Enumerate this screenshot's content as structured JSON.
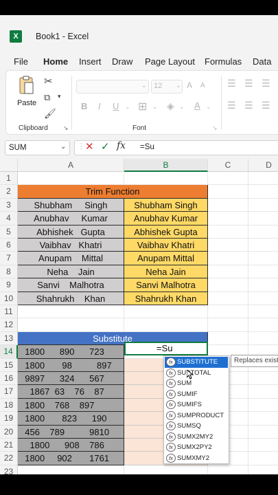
{
  "app": {
    "logo": "X",
    "title": "Book1  -  Excel"
  },
  "tabs": [
    "File",
    "Home",
    "Insert",
    "Draw",
    "Page Layout",
    "Formulas",
    "Data"
  ],
  "ribbon": {
    "paste_label": "Paste",
    "clipboard_label": "Clipboard",
    "font_label": "Font",
    "font_size": "12",
    "bold": "B",
    "italic": "I",
    "underline": "U",
    "font_color": "A"
  },
  "formula_bar": {
    "name_box": "SUM",
    "fx": "fx",
    "formula": "=Su"
  },
  "columns": [
    "A",
    "B",
    "C",
    "D"
  ],
  "rows": [
    "1",
    "2",
    "3",
    "4",
    "5",
    "6",
    "7",
    "8",
    "9",
    "10",
    "11",
    "12",
    "13",
    "14",
    "15",
    "16",
    "17",
    "18",
    "19",
    "20",
    "21",
    "22",
    "23"
  ],
  "trim": {
    "header": "Trim Function",
    "raw": [
      "Shubham     Singh",
      "Anubhav     Kumar",
      "Abhishek   Gupta",
      "Vaibhav   Khatri",
      "Anupam    Mittal",
      "Neha    Jain",
      "Sanvi    Malhotra",
      "Shahrukh    Khan"
    ],
    "clean": [
      "Shubham Singh",
      "Anubhav Kumar",
      "Abhishek Gupta",
      "Vaibhav Khatri",
      "Anupam Mittal",
      "Neha Jain",
      "Sanvi Malhotra",
      "Shahrukh Khan"
    ]
  },
  "substitute": {
    "header": "Substitute",
    "values": [
      "  1800      890      723",
      "  1800       98          897",
      "  9897      324      567",
      "    1867  63    76    87",
      "  1800    768    897",
      "  1800       823      190",
      "  456    789          9810",
      "    1800      908    786",
      "  1800     902       1761"
    ],
    "active_value": "=Su"
  },
  "autocomplete": {
    "items": [
      "SUBSTITUTE",
      "SUBTOTAL",
      "SUM",
      "SUMIF",
      "SUMIFS",
      "SUMPRODUCT",
      "SUMSQ",
      "SUMX2MY2",
      "SUMX2PY2",
      "SUMXMY2"
    ],
    "selected": 0,
    "tooltip": "Replaces existing text"
  },
  "colors": {
    "accent": "#107c41",
    "orange": "#ed7d31",
    "blue": "#4472c4",
    "yellow": "#ffd966"
  }
}
